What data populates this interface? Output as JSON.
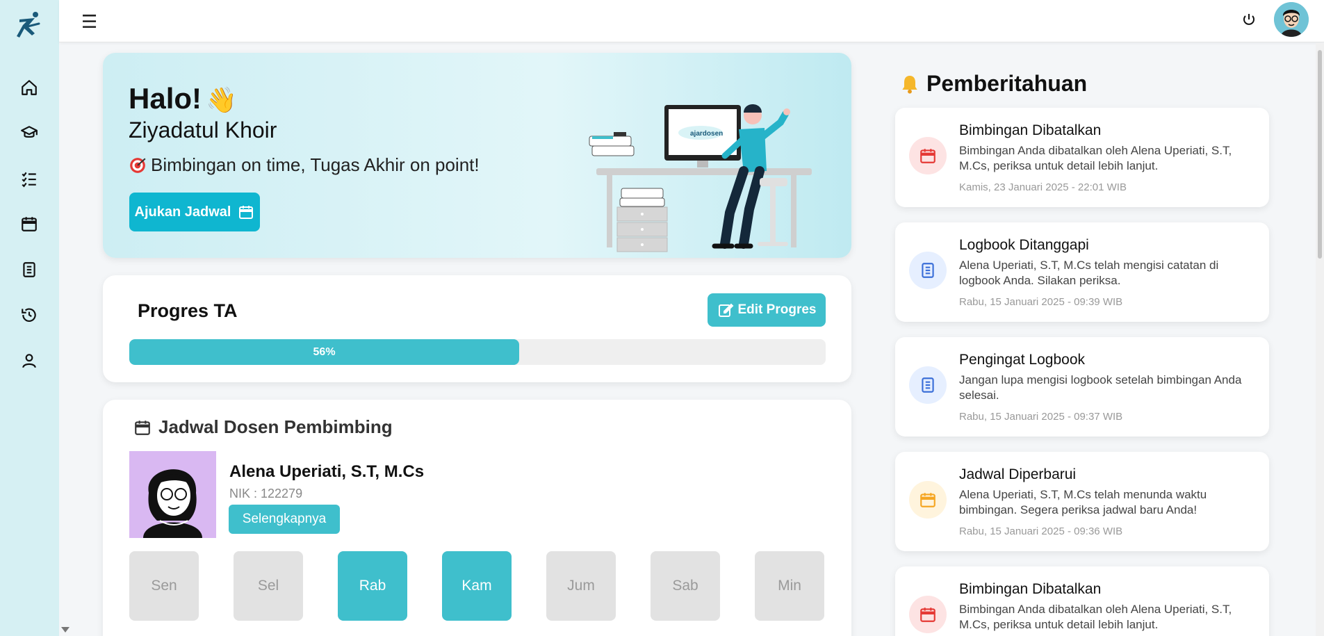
{
  "app": {
    "brand_color": "#0fb6d0",
    "accent_color": "#3fbfcc",
    "sidebar_bg": "#d6f0f3"
  },
  "sidebar": {
    "items": [
      {
        "icon": "home-icon"
      },
      {
        "icon": "graduation-cap-icon"
      },
      {
        "icon": "checklist-icon"
      },
      {
        "icon": "calendar-icon"
      },
      {
        "icon": "logbook-icon"
      },
      {
        "icon": "history-icon"
      },
      {
        "icon": "user-icon"
      }
    ]
  },
  "topbar": {
    "menu_icon": "hamburger-icon",
    "power_icon": "power-icon",
    "avatar": "user-avatar"
  },
  "hero": {
    "greeting": "Halo!",
    "wave": "👋",
    "name": "Ziyadatul Khoir",
    "tagline": "Bimbingan on time, Tugas Akhir on point!",
    "button": "Ajukan Jadwal",
    "monitor_brand": "ajardosen"
  },
  "progress": {
    "title": "Progres TA",
    "edit_label": "Edit Progres",
    "percent": 56,
    "percent_label": "56%"
  },
  "jadwal": {
    "title": "Jadwal Dosen Pembimbing",
    "dosen_name": "Alena Uperiati, S.T, M.Cs",
    "nik": "NIK : 122279",
    "more_label": "Selengkapnya",
    "days": [
      {
        "label": "Sen",
        "active": false
      },
      {
        "label": "Sel",
        "active": false
      },
      {
        "label": "Rab",
        "active": true
      },
      {
        "label": "Kam",
        "active": true
      },
      {
        "label": "Jum",
        "active": false
      },
      {
        "label": "Sab",
        "active": false
      },
      {
        "label": "Min",
        "active": false
      }
    ]
  },
  "notifications": {
    "title": "Pemberitahuan",
    "items": [
      {
        "title": "Bimbingan Dibatalkan",
        "body": "Bimbingan Anda dibatalkan oleh Alena Uperiati, S.T, M.Cs, periksa untuk detail lebih lanjut.",
        "time": "Kamis, 23 Januari 2025 - 22:01 WIB",
        "icon": "calendar-icon",
        "tone": "red"
      },
      {
        "title": "Logbook Ditanggapi",
        "body": "Alena Uperiati, S.T, M.Cs telah mengisi catatan di logbook Anda. Silakan periksa.",
        "time": "Rabu, 15 Januari 2025 - 09:39 WIB",
        "icon": "logbook-icon",
        "tone": "blue"
      },
      {
        "title": "Pengingat Logbook",
        "body": "Jangan lupa mengisi logbook setelah bimbingan Anda selesai.",
        "time": "Rabu, 15 Januari 2025 - 09:37 WIB",
        "icon": "logbook-icon",
        "tone": "blue"
      },
      {
        "title": "Jadwal Diperbarui",
        "body": "Alena Uperiati, S.T, M.Cs telah menunda waktu bimbingan. Segera periksa jadwal baru Anda!",
        "time": "Rabu, 15 Januari 2025 - 09:36 WIB",
        "icon": "calendar-icon",
        "tone": "orange"
      },
      {
        "title": "Bimbingan Dibatalkan",
        "body": "Bimbingan Anda dibatalkan oleh Alena Uperiati, S.T, M.Cs, periksa untuk detail lebih lanjut.",
        "time": "",
        "icon": "calendar-icon",
        "tone": "red"
      }
    ]
  }
}
